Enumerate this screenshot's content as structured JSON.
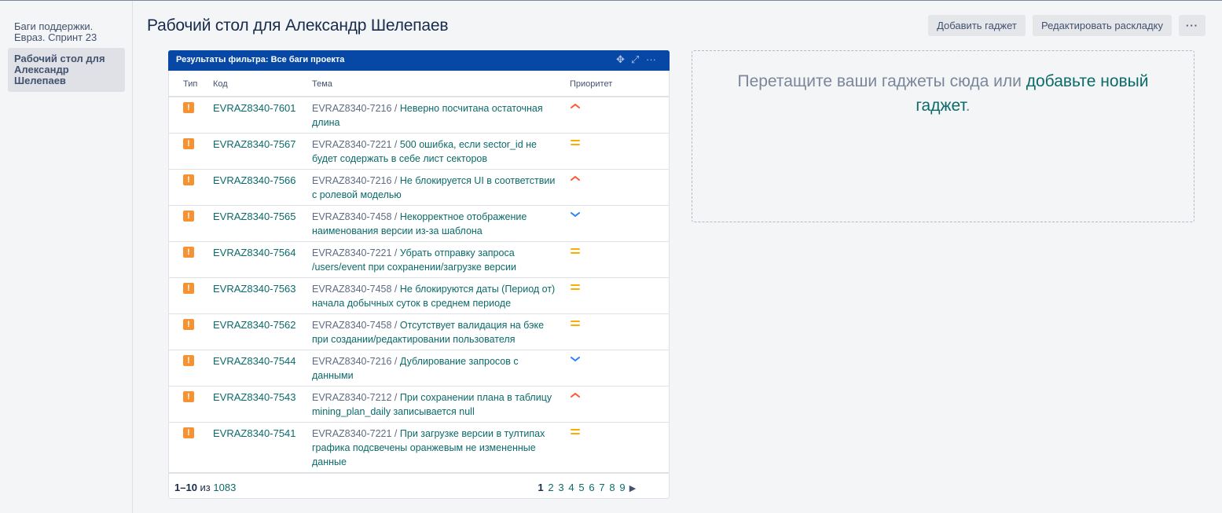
{
  "sidebar": {
    "items": [
      {
        "label": "Баги поддержки. Евраз. Спринт 23"
      },
      {
        "label": "Рабочий стол для Александр Шелепаев"
      }
    ]
  },
  "header": {
    "title": "Рабочий стол для Александр Шелепаев",
    "add_gadget": "Добавить гаджет",
    "edit_layout": "Редактировать раскладку",
    "more": "···"
  },
  "gadget": {
    "title": "Результаты фильтра: Все баги проекта",
    "columns": [
      "Тип",
      "Код",
      "Тема",
      "Приоритет"
    ],
    "rows": [
      {
        "key": "EVRAZ8340-7601",
        "parent": "EVRAZ8340-7216 /",
        "summary": "Неверно посчитана остаточная длина",
        "priority": "high"
      },
      {
        "key": "EVRAZ8340-7567",
        "parent": "EVRAZ8340-7221 /",
        "summary": "500 ошибка, если sector_id не будет содержать в себе лист секторов",
        "priority": "medium"
      },
      {
        "key": "EVRAZ8340-7566",
        "parent": "EVRAZ8340-7216 /",
        "summary": "Не блокируется UI в соответствии с ролевой моделью",
        "priority": "high"
      },
      {
        "key": "EVRAZ8340-7565",
        "parent": "EVRAZ8340-7458 /",
        "summary": "Некорректное отображение наименования версии из-за шаблона",
        "priority": "low"
      },
      {
        "key": "EVRAZ8340-7564",
        "parent": "EVRAZ8340-7221 /",
        "summary": "Убрать отправку запроса /users/event при сохранении/загрузке версии",
        "priority": "medium"
      },
      {
        "key": "EVRAZ8340-7563",
        "parent": "EVRAZ8340-7458 /",
        "summary": "Не блокируются даты (Период от) начала добычных суток в среднем периоде",
        "priority": "medium"
      },
      {
        "key": "EVRAZ8340-7562",
        "parent": "EVRAZ8340-7458 /",
        "summary": "Отсутствует валидация на бэке при создании/редактировании пользователя",
        "priority": "medium"
      },
      {
        "key": "EVRAZ8340-7544",
        "parent": "EVRAZ8340-7216 /",
        "summary": "Дублирование запросов с данными",
        "priority": "low"
      },
      {
        "key": "EVRAZ8340-7543",
        "parent": "EVRAZ8340-7212 /",
        "summary": "При сохранении плана в таблицу mining_plan_daily записывается null",
        "priority": "high"
      },
      {
        "key": "EVRAZ8340-7541",
        "parent": "EVRAZ8340-7221 /",
        "summary": "При загрузке версии в тултипах графика подсвечены оранжевым не измененные данные",
        "priority": "medium"
      }
    ],
    "footer": {
      "range": "1–10",
      "of": "из",
      "total": "1083",
      "pages": [
        "1",
        "2",
        "3",
        "4",
        "5",
        "6",
        "7",
        "8",
        "9"
      ],
      "current_page": "1"
    }
  },
  "dropzone": {
    "text": "Перетащите ваши гаджеты сюда или ",
    "link": "добавьте новый гаджет",
    "suffix": "."
  },
  "colors": {
    "gadget_header": "#0747a6",
    "link": "#0b6a6a",
    "bug_icon": "#f79232",
    "priority_high": "#ff5630",
    "priority_medium": "#ffab00",
    "priority_low": "#2684ff"
  },
  "icons": {
    "type": "bug-warning-icon",
    "move": "move-icon",
    "maximize": "maximize-icon",
    "menu": "more-icon"
  }
}
